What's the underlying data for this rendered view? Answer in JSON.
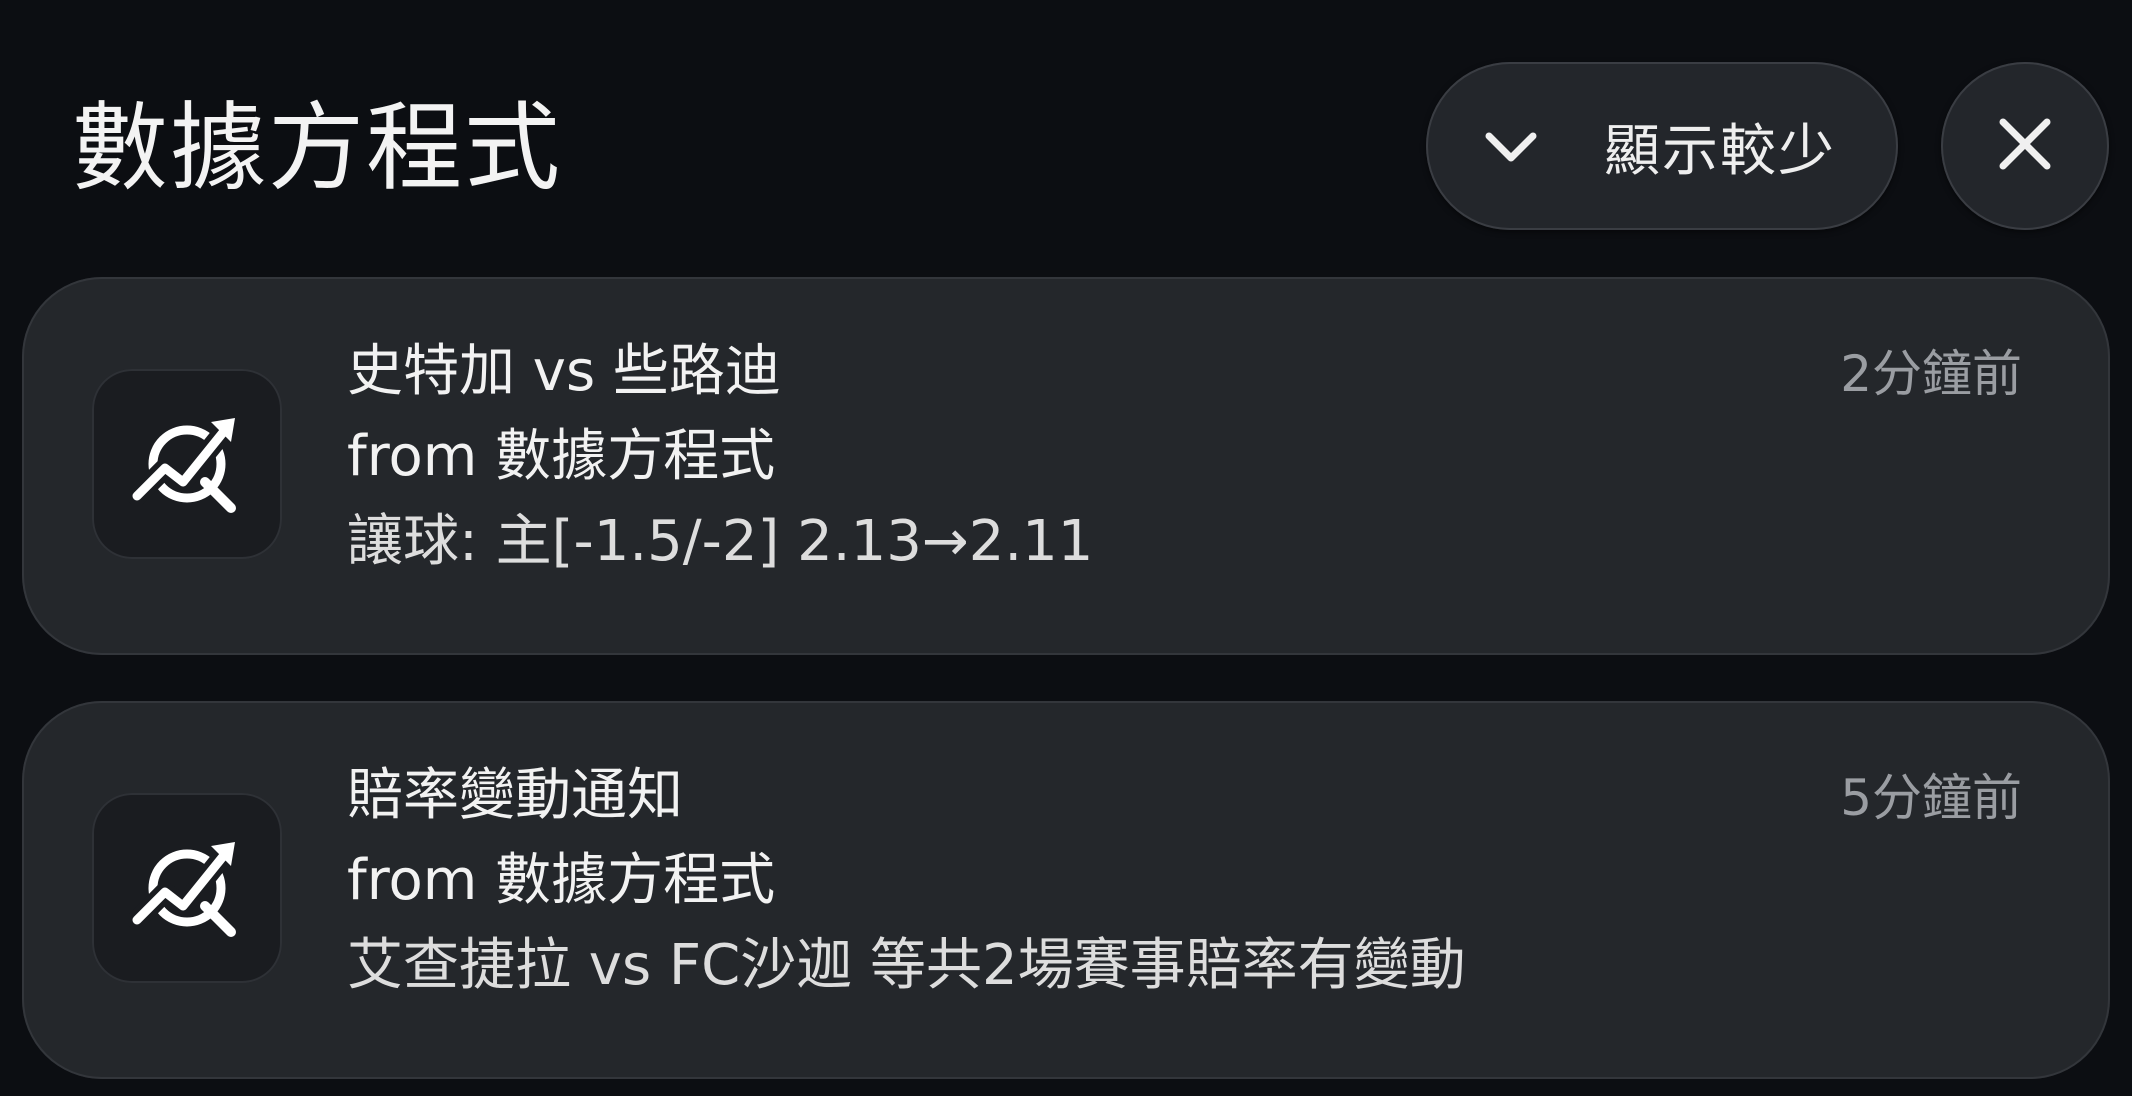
{
  "group": {
    "title": "數據方程式",
    "show_less_label": "顯示較少",
    "show_less_icon": "chevron-down-icon",
    "close_icon": "close-icon"
  },
  "notifications": [
    {
      "app_icon": "chart-trend-icon",
      "title": "史特加 vs 些路迪",
      "source": "from 數據方程式",
      "body": "讓球: 主[-1.5/-2] 2.13→2.11",
      "time": "2分鐘前"
    },
    {
      "app_icon": "chart-trend-icon",
      "title": "賠率變動通知",
      "source": "from 數據方程式",
      "body": "艾查捷拉 vs FC沙迦 等共2場賽事賠率有變動",
      "time": "5分鐘前"
    }
  ],
  "colors": {
    "background": "#0c0e12",
    "card": "#24272b",
    "button": "#23262b",
    "text_primary": "#f2f2f2",
    "text_secondary": "#9a9da2"
  }
}
